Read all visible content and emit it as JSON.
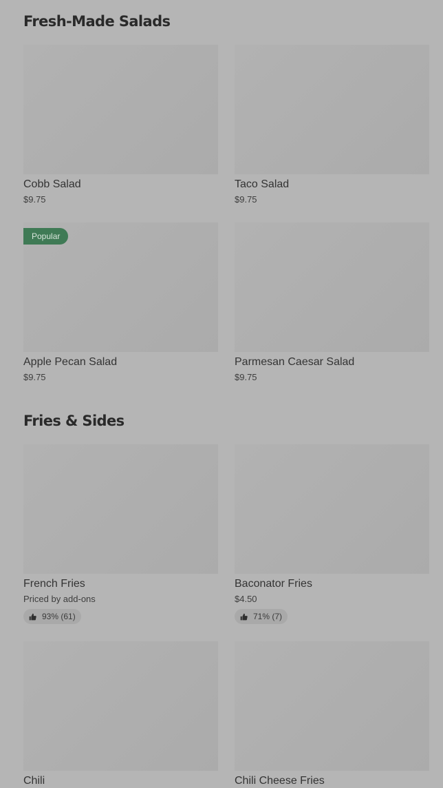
{
  "sections": [
    {
      "title": "Fresh-Made Salads",
      "items": [
        {
          "name": "Cobb Salad",
          "price": "$9.75"
        },
        {
          "name": "Taco Salad",
          "price": "$9.75"
        },
        {
          "name": "Apple Pecan Salad",
          "price": "$9.75",
          "badge": "Popular"
        },
        {
          "name": "Parmesan Caesar Salad",
          "price": "$9.75"
        }
      ]
    },
    {
      "title": "Fries & Sides",
      "items": [
        {
          "name": "French Fries",
          "price": "Priced by add-ons",
          "rating": "93% (61)"
        },
        {
          "name": "Baconator Fries",
          "price": "$4.50",
          "rating": "71% (7)"
        },
        {
          "name": "Chili"
        },
        {
          "name": "Chili Cheese Fries"
        }
      ]
    }
  ]
}
